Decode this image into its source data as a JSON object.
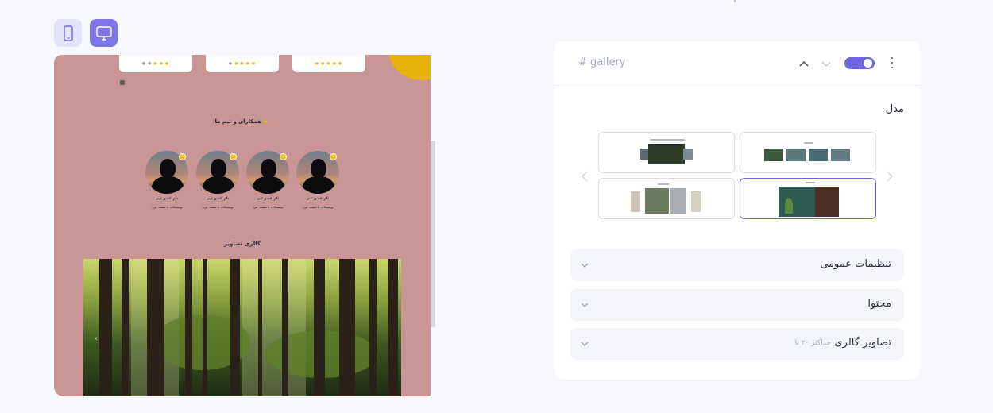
{
  "device_toggle": {
    "mobile_icon": "mobile-icon",
    "desktop_icon": "monitor-icon",
    "active": "desktop"
  },
  "preview": {
    "reviews": [
      {
        "stars_filled": 3,
        "stars_total": 5
      },
      {
        "stars_filled": 4,
        "stars_total": 5
      },
      {
        "stars_filled": 5,
        "stars_total": 5
      }
    ],
    "team_title": "همکاران و تیم ما",
    "members": [
      {
        "name": "نام عضو تیم",
        "role": "توضیحات یا سمت فرد"
      },
      {
        "name": "نام عضو تیم",
        "role": "توضیحات یا سمت فرد"
      },
      {
        "name": "نام عضو تیم",
        "role": "توضیحات یا سمت فرد"
      },
      {
        "name": "نام عضو تیم",
        "role": "توضیحات یا سمت فرد"
      }
    ],
    "gallery_title": "گالری تصاویر",
    "gallery_arrow": "‹"
  },
  "panel": {
    "section_tag": "# gallery",
    "toggle_on": true,
    "model_label": "مدل",
    "prev_arrow": "‹",
    "next_arrow": "›",
    "accordions": [
      {
        "title": "تنظیمات عمومی",
        "hint": ""
      },
      {
        "title": "محتوا",
        "hint": ""
      },
      {
        "title": "تصاویر گالری",
        "hint": "حداکثر ۲۰ تا"
      }
    ]
  },
  "colors": {
    "accent": "#6e67e0",
    "preview_bg": "#c99595",
    "star": "#f2b705"
  }
}
